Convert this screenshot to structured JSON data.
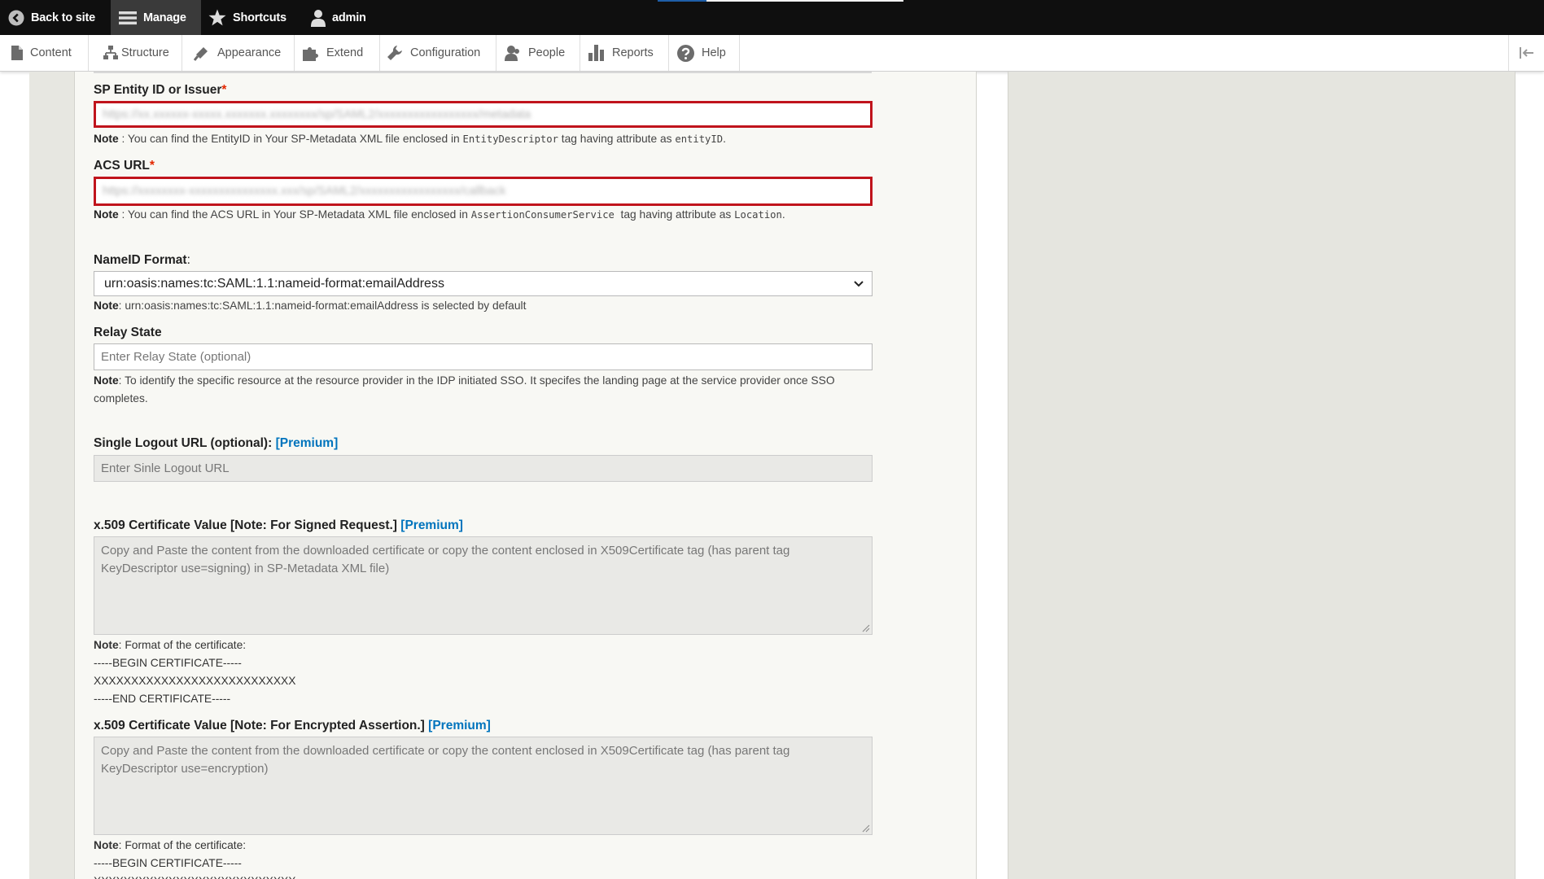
{
  "toolbar": {
    "back_label": "Back to site",
    "manage_label": "Manage",
    "shortcuts_label": "Shortcuts",
    "user_label": "admin"
  },
  "tray": {
    "tabs": [
      "Content",
      "Structure",
      "Appearance",
      "Extend",
      "Configuration",
      "People",
      "Reports",
      "Help"
    ]
  },
  "form": {
    "sp_entity": {
      "label": "SP Entity ID or Issuer",
      "required_mark": "*",
      "value": "https://xx.xxxxxx-xxxxx.xxxxxxx.xxxxxxxx/sp/SAML2/xxxxxxxxxxxxxxxxx/metadata",
      "note_label": "Note",
      "note_pre": " : You can find the EntityID in Your SP-Metadata XML file enclosed in ",
      "note_code1": "EntityDescriptor",
      "note_mid": " tag having attribute as ",
      "note_code2": "entityID",
      "note_end": "."
    },
    "acs_url": {
      "label": "ACS URL",
      "required_mark": "*",
      "value": "https://xxxxxxxx-xxxxxxxxxxxxxxx.xxx/sp/SAML2/xxxxxxxxxxxxxxxxx/callback",
      "note_label": "Note",
      "note_pre": " : You can find the ACS URL in Your SP-Metadata XML file enclosed in ",
      "note_code1": "AssertionConsumerService",
      "note_mid": "  tag having attribute as ",
      "note_code2": "Location",
      "note_end": "."
    },
    "nameid": {
      "label": "NameID Format",
      "colon": ":",
      "selected": "urn:oasis:names:tc:SAML:1.1:nameid-format:emailAddress",
      "note_label": "Note",
      "note_text": ": urn:oasis:names:tc:SAML:1.1:nameid-format:emailAddress is selected by default"
    },
    "relay": {
      "label": "Relay State",
      "placeholder": "Enter Relay State (optional)",
      "note_label": "Note",
      "note_line1": ": To identify the specific resource at the resource provider in the IDP initiated SSO. It specifes the landing page at the service provider once SSO",
      "note_line2": "completes."
    },
    "logout": {
      "label": "Single Logout URL (optional):",
      "premium": "[Premium]",
      "placeholder": "Enter Sinle Logout URL"
    },
    "cert_signed": {
      "label": "x.509 Certificate Value [Note: For Signed Request.]",
      "premium": "[Premium]",
      "placeholder_line1": "Copy and Paste the content from the downloaded certificate or copy the content enclosed in X509Certificate tag (has parent tag",
      "placeholder_line2": "KeyDescriptor use=signing) in SP-Metadata XML file)",
      "note_label": "Note",
      "note_text": ": Format of the certificate:",
      "begin": "-----BEGIN CERTIFICATE-----",
      "body": "XXXXXXXXXXXXXXXXXXXXXXXXXXX",
      "end": "-----END CERTIFICATE-----"
    },
    "cert_encrypted": {
      "label": "x.509 Certificate Value [Note: For Encrypted Assertion.]",
      "premium": "[Premium]",
      "placeholder_line1": "Copy and Paste the content from the downloaded certificate or copy the content enclosed in X509Certificate tag (has parent tag",
      "placeholder_line2": "KeyDescriptor use=encryption)",
      "note_label": "Note",
      "note_text": ": Format of the certificate:",
      "begin": "-----BEGIN CERTIFICATE-----",
      "body": "XXXXXXXXXXXXXXXXXXXXXXXXXXX"
    }
  },
  "colors": {
    "toolbar_bg": "#0f0f0f",
    "required": "#e32700",
    "premium_link": "#0074bd",
    "highlight_border": "#c0141c"
  }
}
